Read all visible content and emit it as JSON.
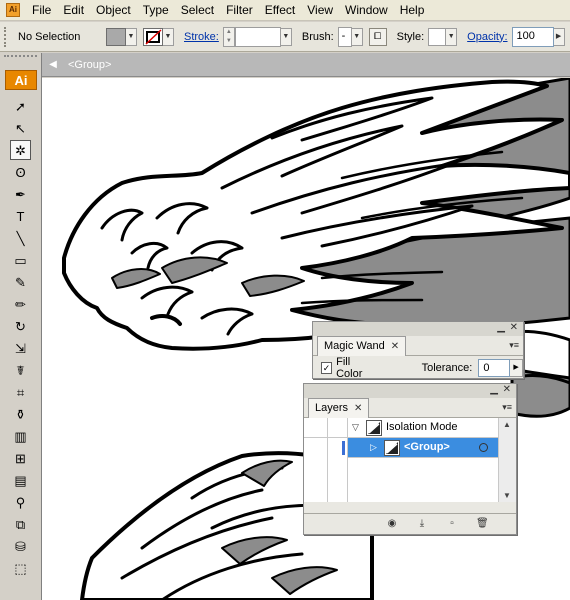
{
  "app": {
    "icon_label": "Ai"
  },
  "menu": [
    "File",
    "Edit",
    "Object",
    "Type",
    "Select",
    "Filter",
    "Effect",
    "View",
    "Window",
    "Help"
  ],
  "controlbar": {
    "selection_status": "No Selection",
    "stroke_label": "Stroke:",
    "brush_label": "Brush:",
    "brush_value": "-",
    "style_label": "Style:",
    "opacity_label": "Opacity:",
    "opacity_value": "100"
  },
  "isolation_bar": {
    "back_icon": "arrow-left-icon",
    "label": "<Group>"
  },
  "toolbox": {
    "logo": "Ai",
    "tools": [
      {
        "name": "selection-tool",
        "glyph": "➚"
      },
      {
        "name": "direct-selection-tool",
        "glyph": "↖"
      },
      {
        "name": "magic-wand-tool",
        "glyph": "✲",
        "active": true
      },
      {
        "name": "lasso-tool",
        "glyph": "ʘ"
      },
      {
        "name": "pen-tool",
        "glyph": "✒"
      },
      {
        "name": "type-tool",
        "glyph": "T"
      },
      {
        "name": "line-segment-tool",
        "glyph": "╲"
      },
      {
        "name": "rectangle-tool",
        "glyph": "▭"
      },
      {
        "name": "paintbrush-tool",
        "glyph": "✎"
      },
      {
        "name": "pencil-tool",
        "glyph": "✏"
      },
      {
        "name": "rotate-tool",
        "glyph": "↻"
      },
      {
        "name": "scale-tool",
        "glyph": "⇲"
      },
      {
        "name": "warp-tool",
        "glyph": "☤"
      },
      {
        "name": "free-transform-tool",
        "glyph": "⌗"
      },
      {
        "name": "symbol-sprayer-tool",
        "glyph": "⚱"
      },
      {
        "name": "column-graph-tool",
        "glyph": "▥"
      },
      {
        "name": "mesh-tool",
        "glyph": "⊞"
      },
      {
        "name": "gradient-tool",
        "glyph": "▤"
      },
      {
        "name": "eyedropper-tool",
        "glyph": "⚲"
      },
      {
        "name": "blend-tool",
        "glyph": "⧉"
      },
      {
        "name": "live-paint-bucket-tool",
        "glyph": "⛁"
      },
      {
        "name": "live-paint-selection-tool",
        "glyph": "⬚"
      }
    ]
  },
  "magic_wand_panel": {
    "tab_label": "Magic Wand",
    "fill_color_label": "Fill Color",
    "fill_color_checked": "✓",
    "tolerance_label": "Tolerance:",
    "tolerance_value": "0"
  },
  "layers_panel": {
    "tab_label": "Layers",
    "rows": [
      {
        "name": "Isolation Mode",
        "expanded": true
      },
      {
        "name": "<Group>",
        "selected": true
      }
    ]
  },
  "colors": {
    "accent_selection": "#3b8de0",
    "logo_orange": "#e88700",
    "link_blue": "#0033aa"
  }
}
